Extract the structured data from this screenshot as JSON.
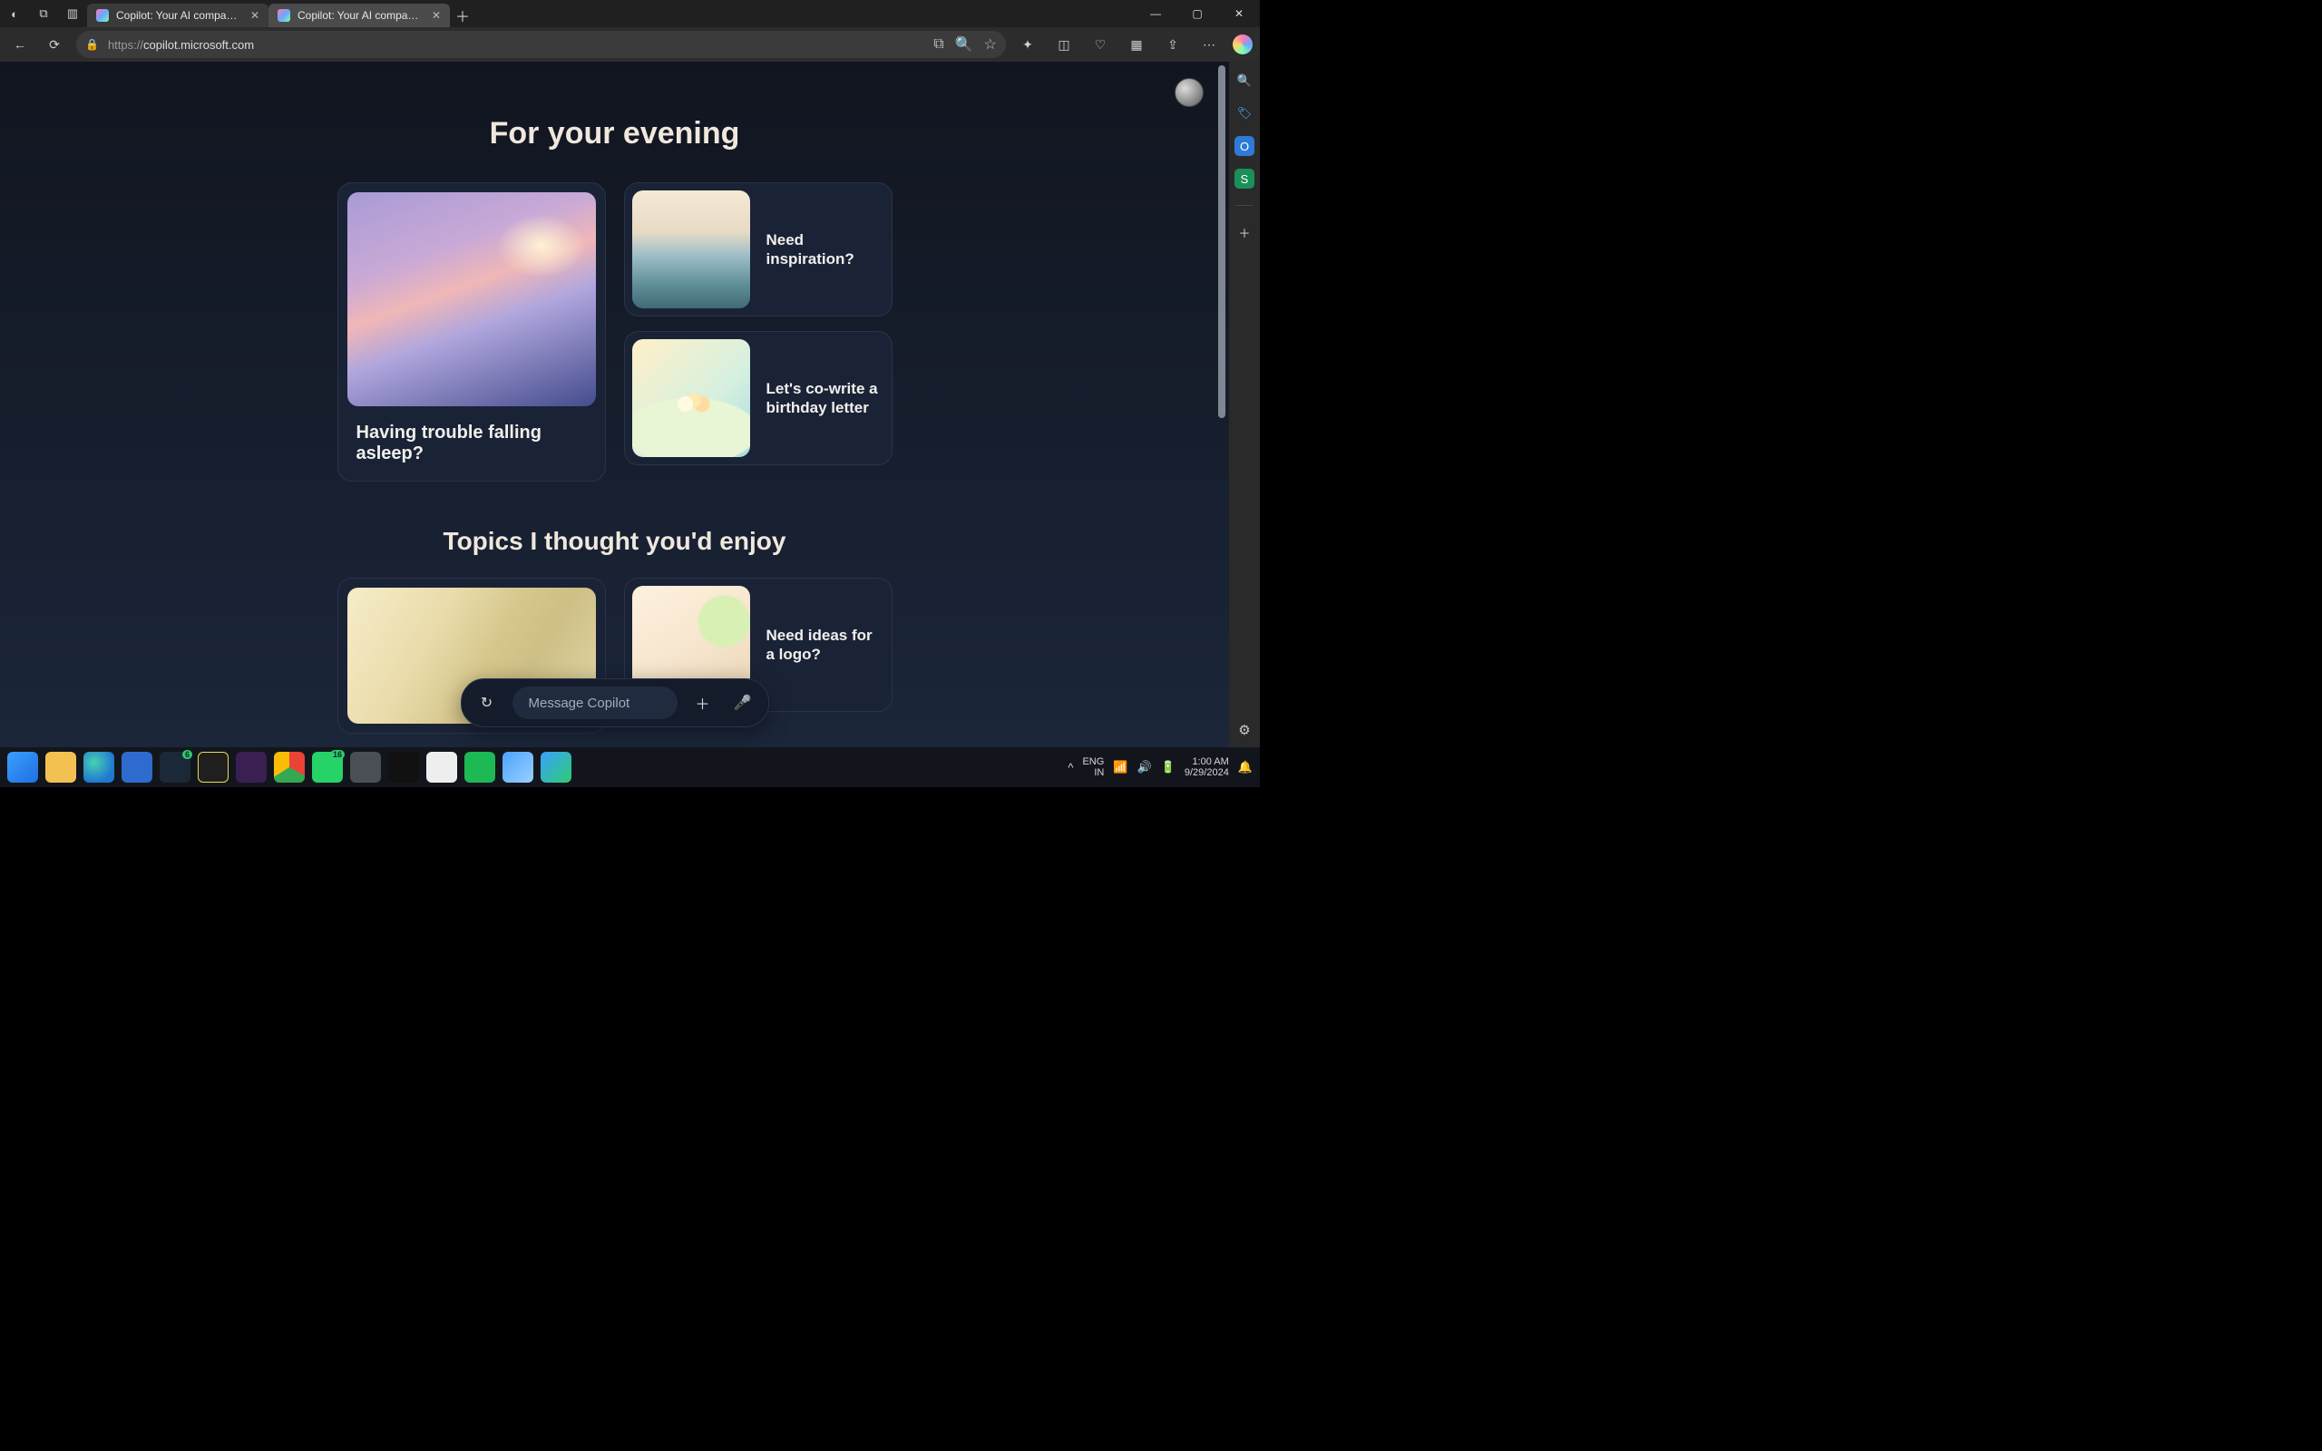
{
  "browser": {
    "tabs": [
      {
        "label": "Copilot: Your AI companion",
        "active": false
      },
      {
        "label": "Copilot: Your AI companion",
        "active": true
      }
    ],
    "url_protocol": "https://",
    "url_host": "copilot.microsoft.com"
  },
  "page": {
    "section1_title": "For your evening",
    "section2_title": "Topics I thought you'd enjoy",
    "cards1": {
      "big": "Having trouble falling asleep?",
      "small_a": "Need inspiration?",
      "small_b": "Let's co-write a birthday letter"
    },
    "cards2": {
      "small_a": "Need ideas for a logo?"
    },
    "input_placeholder": "Message Copilot"
  },
  "system": {
    "lang_top": "ENG",
    "lang_bot": "IN",
    "time": "1:00 AM",
    "date": "9/29/2024",
    "whatsapp_badge": "16",
    "steam_badge": "6"
  }
}
